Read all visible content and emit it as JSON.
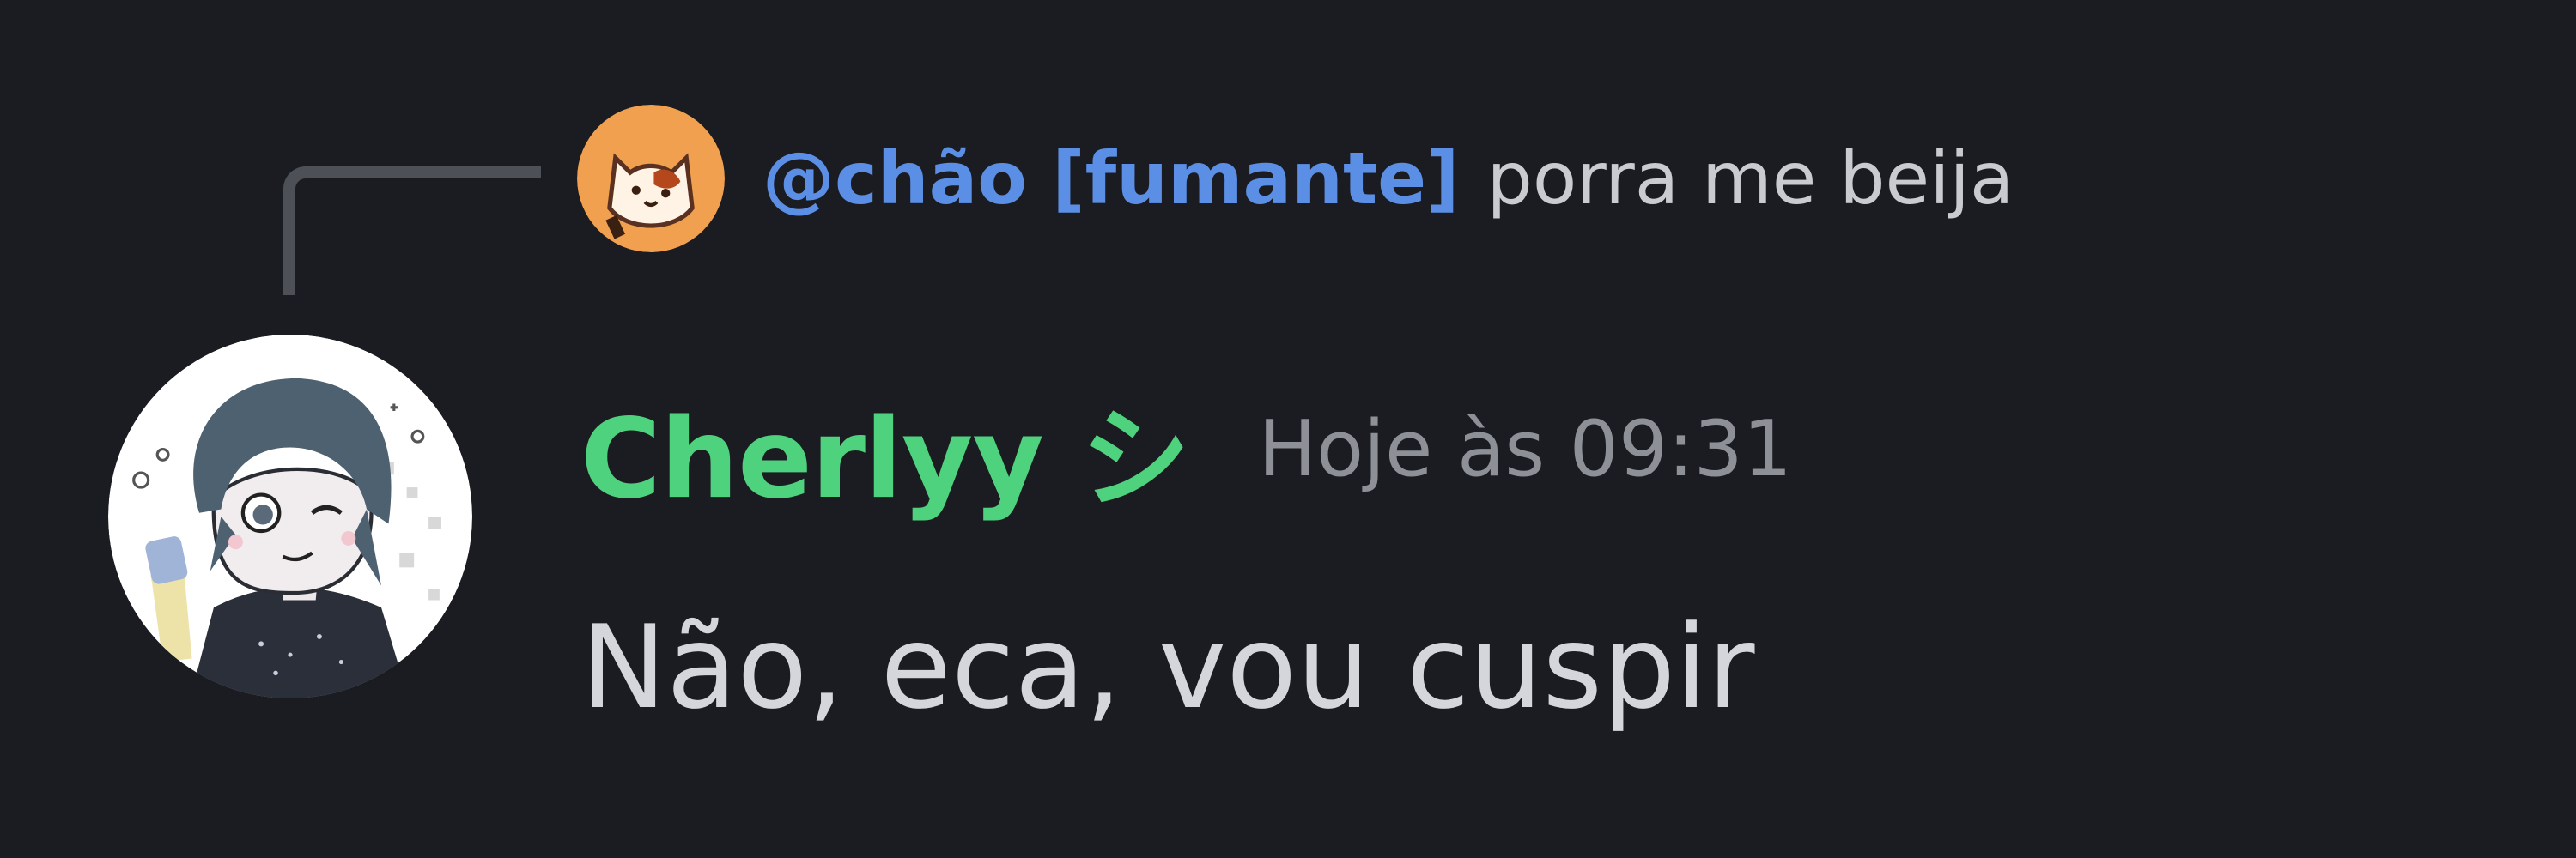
{
  "reply": {
    "author": "@chão [fumante]",
    "text": "porra me beija"
  },
  "message": {
    "username": "Cherlyy シ",
    "timestamp": "Hoje às 09:31",
    "text": "Não, eca, vou cuspir"
  },
  "colors": {
    "background": "#1b1c21",
    "reply_author": "#5b8fe6",
    "username": "#4fd27e",
    "timestamp": "#8e9098",
    "message_text": "#d5d6db"
  }
}
